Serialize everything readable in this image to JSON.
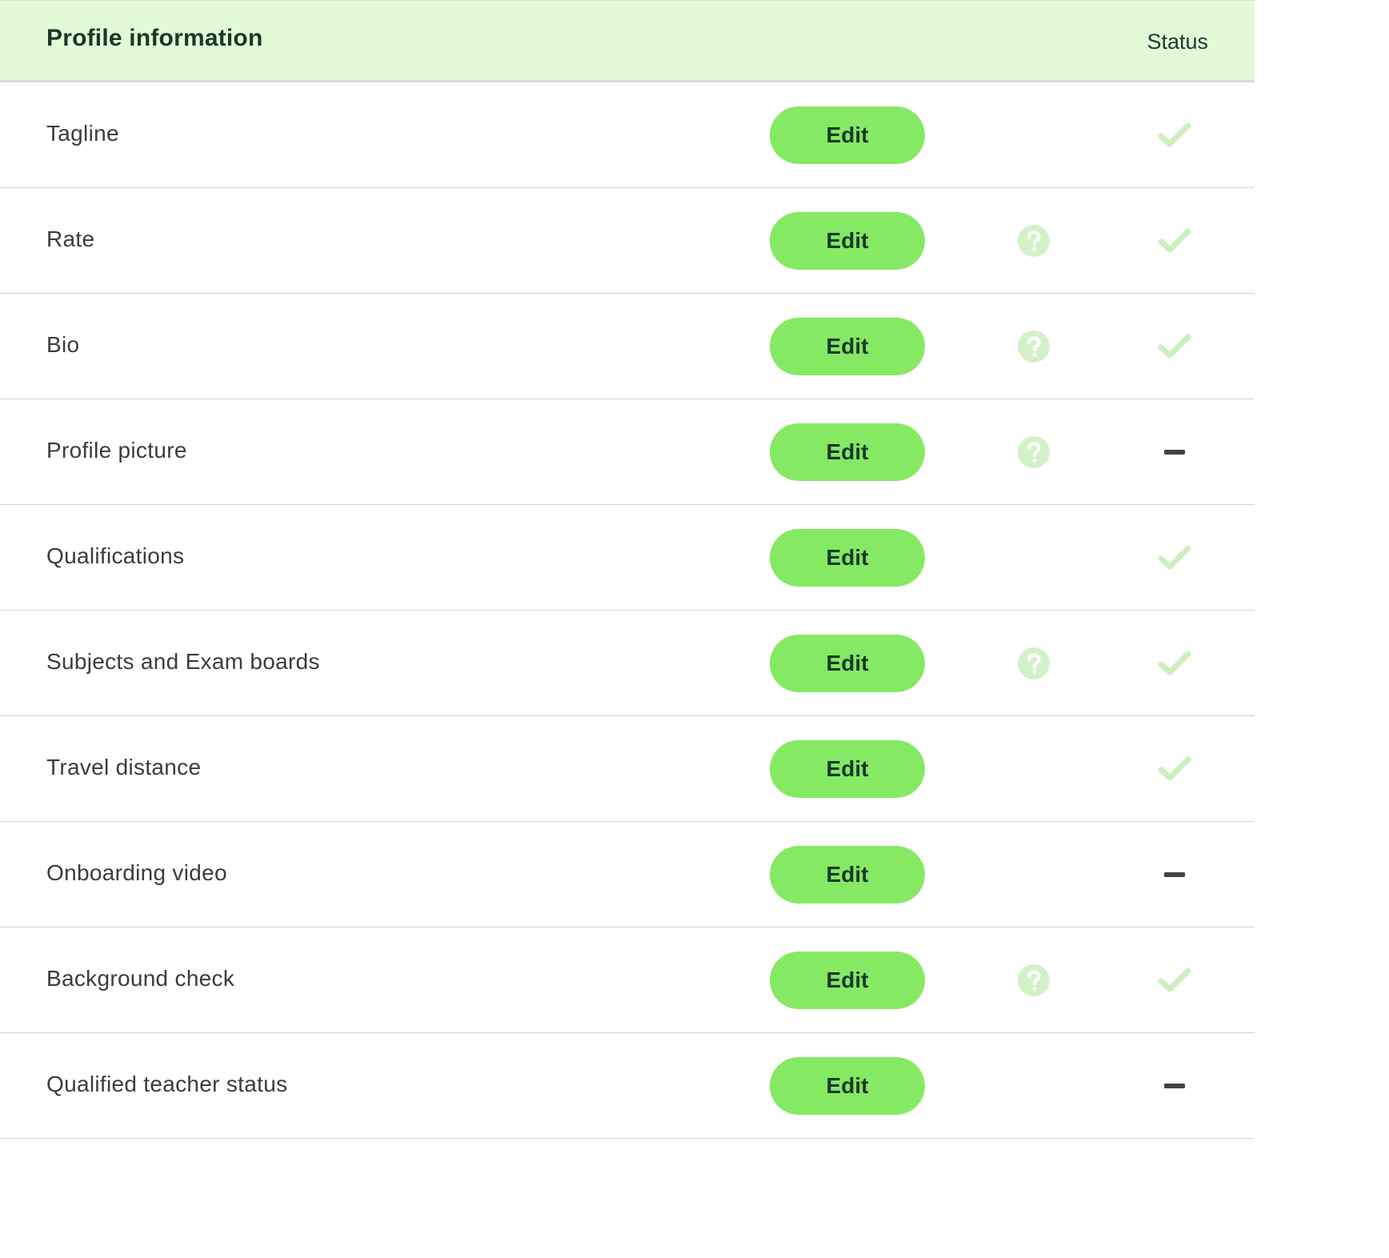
{
  "header": {
    "title": "Profile information",
    "status_label": "Status"
  },
  "colors": {
    "header_bg": "#e2fad5",
    "button_bg": "#86e963",
    "button_text": "#16392a",
    "help_icon": "#d3f1c6",
    "check_icon": "#cbf0bd",
    "dash_icon": "#3f4448"
  },
  "rows": [
    {
      "label": "Tagline",
      "edit_label": "Edit",
      "has_help": false,
      "status": "complete",
      "status_icon": "check-icon"
    },
    {
      "label": "Rate",
      "edit_label": "Edit",
      "has_help": true,
      "status": "complete",
      "status_icon": "check-icon"
    },
    {
      "label": "Bio",
      "edit_label": "Edit",
      "has_help": true,
      "status": "complete",
      "status_icon": "check-icon"
    },
    {
      "label": "Profile picture",
      "edit_label": "Edit",
      "has_help": true,
      "status": "incomplete",
      "status_icon": "dash-icon"
    },
    {
      "label": "Qualifications",
      "edit_label": "Edit",
      "has_help": false,
      "status": "complete",
      "status_icon": "check-icon"
    },
    {
      "label": "Subjects and Exam boards",
      "edit_label": "Edit",
      "has_help": true,
      "status": "complete",
      "status_icon": "check-icon"
    },
    {
      "label": "Travel distance",
      "edit_label": "Edit",
      "has_help": false,
      "status": "complete",
      "status_icon": "check-icon"
    },
    {
      "label": "Onboarding video",
      "edit_label": "Edit",
      "has_help": false,
      "status": "incomplete",
      "status_icon": "dash-icon"
    },
    {
      "label": "Background check",
      "edit_label": "Edit",
      "has_help": true,
      "status": "complete",
      "status_icon": "check-icon"
    },
    {
      "label": "Qualified teacher status",
      "edit_label": "Edit",
      "has_help": false,
      "status": "incomplete",
      "status_icon": "dash-icon"
    }
  ]
}
